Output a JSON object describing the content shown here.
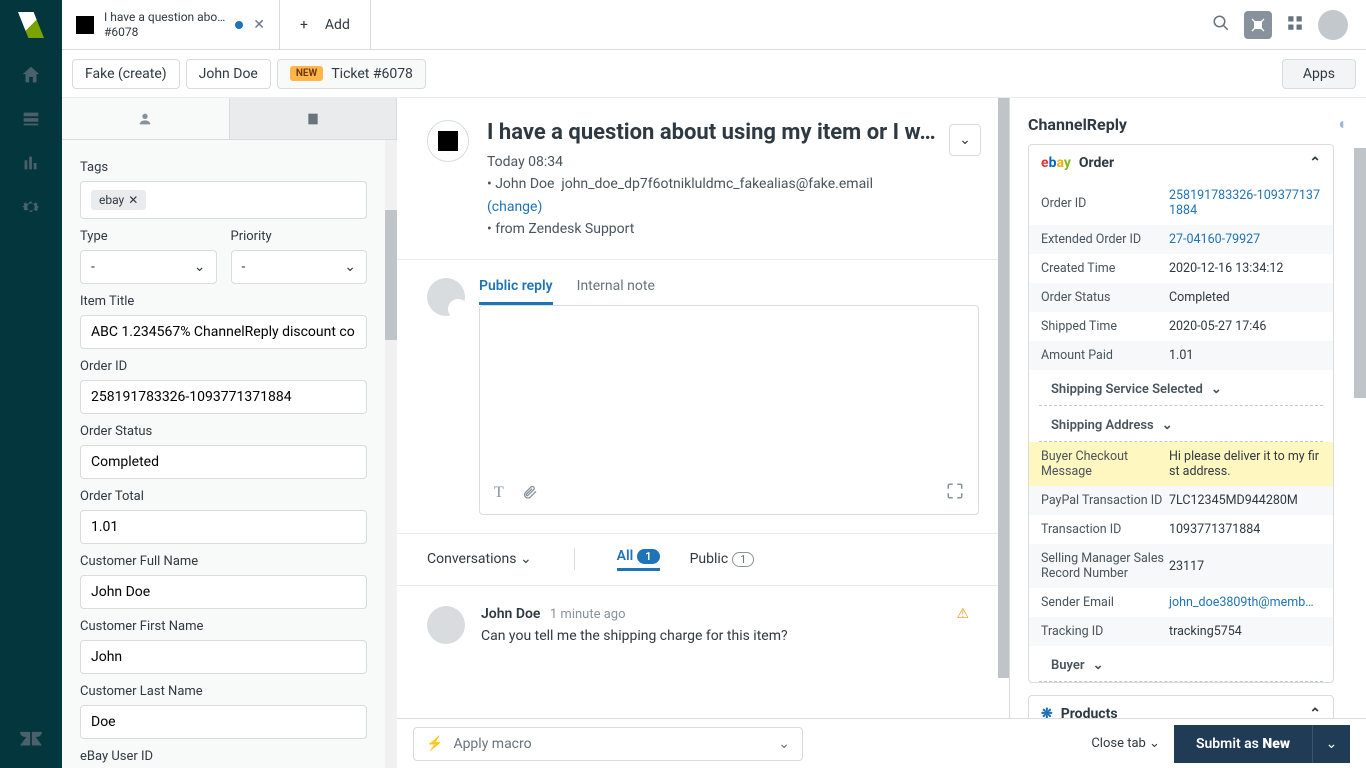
{
  "tab": {
    "title": "I have a question abo…",
    "subtitle": "#6078",
    "add": "Add"
  },
  "crumbs": {
    "fake": "Fake (create)",
    "user": "John Doe",
    "new": "NEW",
    "ticket": "Ticket #6078",
    "apps": "Apps"
  },
  "fields": {
    "tags_label": "Tags",
    "tag": "ebay",
    "type_label": "Type",
    "type_val": "-",
    "priority_label": "Priority",
    "priority_val": "-",
    "item_title_label": "Item Title",
    "item_title": "ABC 1.234567% ChannelReply discount co",
    "orderid_label": "Order ID",
    "orderid": "258191783326-1093771371884",
    "orderstatus_label": "Order Status",
    "orderstatus": "Completed",
    "ordertotal_label": "Order Total",
    "ordertotal": "1.01",
    "fullname_label": "Customer Full Name",
    "fullname": "John Doe",
    "firstname_label": "Customer First Name",
    "firstname": "John",
    "lastname_label": "Customer Last Name",
    "lastname": "Doe",
    "ebayuser_label": "eBay User ID"
  },
  "ticket": {
    "title": "I have a question about using my item or I w…",
    "time": "Today 08:34",
    "requester_name": "John Doe",
    "requester_email": "john_doe_dp7f6otnikluldmc_fakealias@fake.email",
    "change": "(change)",
    "via": "• from Zendesk Support",
    "public_reply": "Public reply",
    "internal_note": "Internal note",
    "conversations": "Conversations",
    "all": "All",
    "all_n": "1",
    "public": "Public",
    "public_n": "1",
    "msg_author": "John Doe",
    "msg_time": "1 minute ago",
    "msg_body": "Can you tell me the shipping charge for this item?"
  },
  "app": {
    "title": "ChannelReply",
    "order": "Order",
    "rows": {
      "orderid_k": "Order ID",
      "orderid_v": "258191783326-1093771371884",
      "extid_k": "Extended Order ID",
      "extid_v": "27-04160-79927",
      "created_k": "Created Time",
      "created_v": "2020-12-16 13:34:12",
      "status_k": "Order Status",
      "status_v": "Completed",
      "shipped_k": "Shipped Time",
      "shipped_v": "2020-05-27 17:46",
      "paid_k": "Amount Paid",
      "paid_v": "1.01",
      "shipsvc": "Shipping Service Selected",
      "shipaddr": "Shipping Address",
      "checkout_k": "Buyer Checkout Message",
      "checkout_v": "Hi please deliver it to my first address.",
      "paypal_k": "PayPal Transaction ID",
      "paypal_v": "7LC12345MD944280M",
      "txn_k": "Transaction ID",
      "txn_v": "1093771371884",
      "smr_k": "Selling Manager Sales Record Number",
      "smr_v": "23117",
      "sender_k": "Sender Email",
      "sender_v": "john_doe3809th@memb…",
      "track_k": "Tracking ID",
      "track_v": "tracking5754",
      "buyer": "Buyer"
    },
    "products": "Products"
  },
  "footer": {
    "macro": "Apply macro",
    "close": "Close tab",
    "submit": "Submit as",
    "status": "New"
  }
}
